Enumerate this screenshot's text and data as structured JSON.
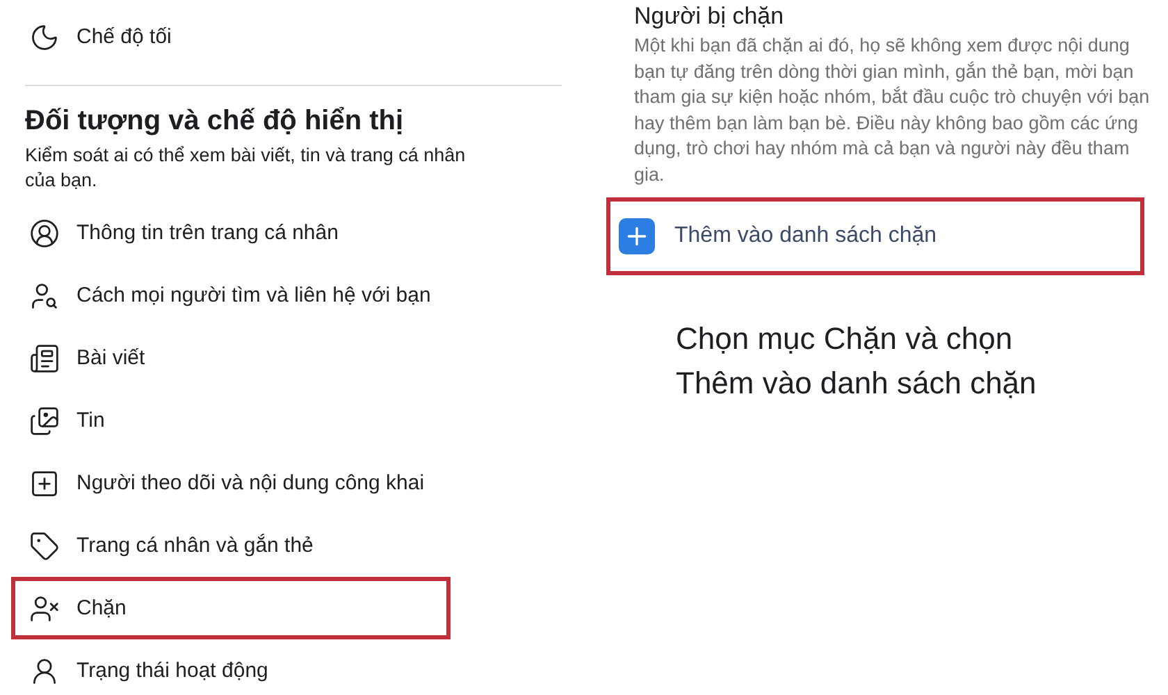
{
  "left_panel": {
    "top_item": {
      "label": "Chế độ tối"
    },
    "section": {
      "title": "Đối tượng và chế độ hiển thị",
      "description": "Kiểm soát ai có thể xem bài viết, tin và trang cá nhân của bạn."
    },
    "items": [
      {
        "label": "Thông tin trên trang cá nhân",
        "highlighted": false
      },
      {
        "label": "Cách mọi người tìm và liên hệ với bạn",
        "highlighted": false
      },
      {
        "label": "Bài viết",
        "highlighted": false
      },
      {
        "label": "Tin",
        "highlighted": false
      },
      {
        "label": "Người theo dõi và nội dung công khai",
        "highlighted": false
      },
      {
        "label": "Trang cá nhân và gắn thẻ",
        "highlighted": false
      },
      {
        "label": "Chặn",
        "highlighted": true
      },
      {
        "label": "Trạng thái hoạt động",
        "highlighted": false
      }
    ]
  },
  "right_panel": {
    "title": "Người bị chặn",
    "description": "Một khi bạn đã chặn ai đó, họ sẽ không xem được nội dung bạn tự đăng trên dòng thời gian mình, gắn thẻ bạn, mời bạn tham gia sự kiện hoặc nhóm, bắt đầu cuộc trò chuyện với bạn hay thêm bạn làm bạn bè. Điều này không bao gồm các ứng dụng, trò chơi hay nhóm mà cả bạn và người này đều tham gia.",
    "add_button": {
      "label": "Thêm vào danh sách chặn",
      "highlighted": true
    }
  },
  "caption": [
    "Chọn mục Chặn và chọn",
    "Thêm vào danh sách chặn"
  ]
}
